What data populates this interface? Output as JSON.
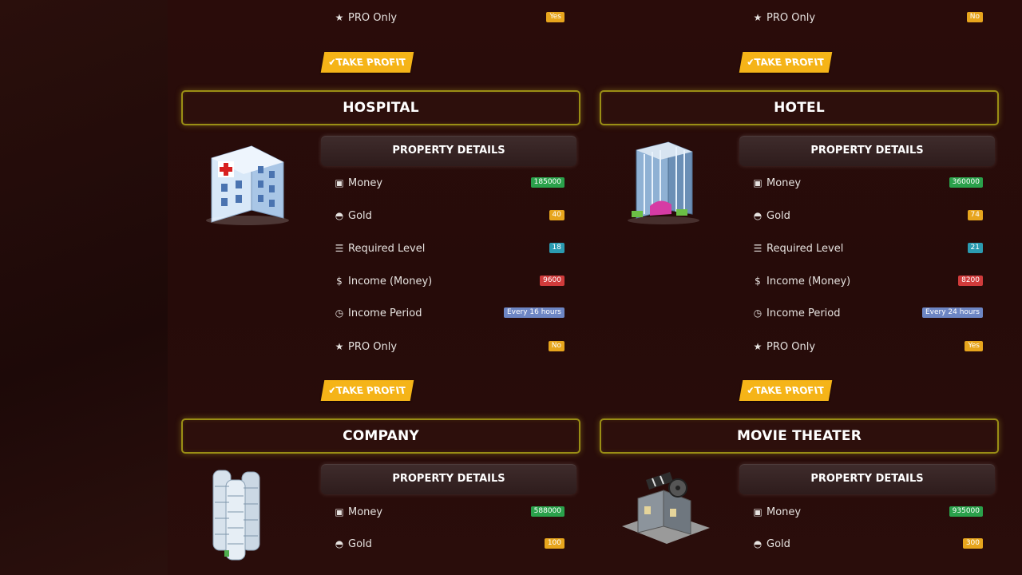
{
  "labels": {
    "take_profit": "TAKE PROFIT",
    "property_details": "PROPERTY DETAILS",
    "money": "Money",
    "gold": "Gold",
    "required_level": "Required Level",
    "income_money": "Income (Money)",
    "income_period": "Income Period",
    "pro_only": "PRO Only"
  },
  "top_partial": {
    "left": {
      "pro_only": "Yes"
    },
    "right": {
      "pro_only": "No"
    }
  },
  "properties": [
    {
      "name": "HOSPITAL",
      "icon": "hospital-building-icon",
      "money": "185000",
      "gold": "40",
      "required_level": "18",
      "income_money": "9600",
      "income_period": "Every 16 hours",
      "pro_only": "No"
    },
    {
      "name": "HOTEL",
      "icon": "hotel-building-icon",
      "money": "360000",
      "gold": "74",
      "required_level": "21",
      "income_money": "8200",
      "income_period": "Every 24 hours",
      "pro_only": "Yes"
    },
    {
      "name": "COMPANY",
      "icon": "company-towers-icon",
      "money": "588000",
      "gold": "100"
    },
    {
      "name": "MOVIE THEATER",
      "icon": "movie-theater-icon",
      "money": "935000",
      "gold": "300"
    }
  ]
}
